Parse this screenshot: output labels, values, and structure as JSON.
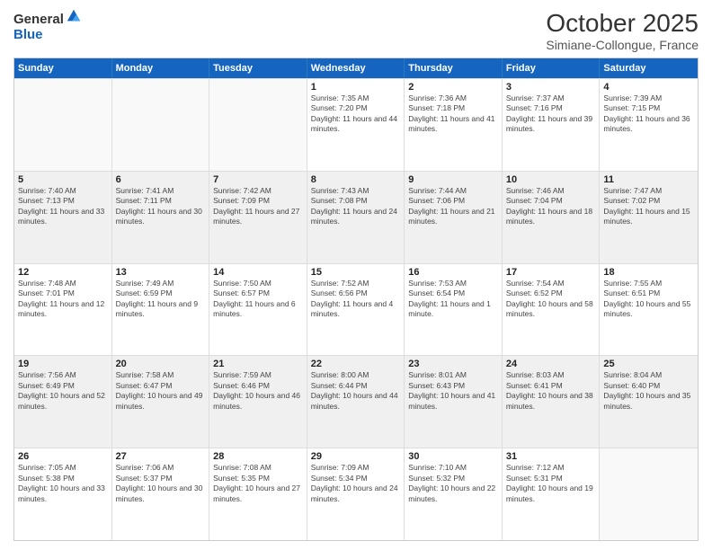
{
  "logo": {
    "general": "General",
    "blue": "Blue"
  },
  "title": "October 2025",
  "subtitle": "Simiane-Collongue, France",
  "header_days": [
    "Sunday",
    "Monday",
    "Tuesday",
    "Wednesday",
    "Thursday",
    "Friday",
    "Saturday"
  ],
  "rows": [
    [
      {
        "day": "",
        "info": ""
      },
      {
        "day": "",
        "info": ""
      },
      {
        "day": "",
        "info": ""
      },
      {
        "day": "1",
        "info": "Sunrise: 7:35 AM\nSunset: 7:20 PM\nDaylight: 11 hours and 44 minutes."
      },
      {
        "day": "2",
        "info": "Sunrise: 7:36 AM\nSunset: 7:18 PM\nDaylight: 11 hours and 41 minutes."
      },
      {
        "day": "3",
        "info": "Sunrise: 7:37 AM\nSunset: 7:16 PM\nDaylight: 11 hours and 39 minutes."
      },
      {
        "day": "4",
        "info": "Sunrise: 7:39 AM\nSunset: 7:15 PM\nDaylight: 11 hours and 36 minutes."
      }
    ],
    [
      {
        "day": "5",
        "info": "Sunrise: 7:40 AM\nSunset: 7:13 PM\nDaylight: 11 hours and 33 minutes."
      },
      {
        "day": "6",
        "info": "Sunrise: 7:41 AM\nSunset: 7:11 PM\nDaylight: 11 hours and 30 minutes."
      },
      {
        "day": "7",
        "info": "Sunrise: 7:42 AM\nSunset: 7:09 PM\nDaylight: 11 hours and 27 minutes."
      },
      {
        "day": "8",
        "info": "Sunrise: 7:43 AM\nSunset: 7:08 PM\nDaylight: 11 hours and 24 minutes."
      },
      {
        "day": "9",
        "info": "Sunrise: 7:44 AM\nSunset: 7:06 PM\nDaylight: 11 hours and 21 minutes."
      },
      {
        "day": "10",
        "info": "Sunrise: 7:46 AM\nSunset: 7:04 PM\nDaylight: 11 hours and 18 minutes."
      },
      {
        "day": "11",
        "info": "Sunrise: 7:47 AM\nSunset: 7:02 PM\nDaylight: 11 hours and 15 minutes."
      }
    ],
    [
      {
        "day": "12",
        "info": "Sunrise: 7:48 AM\nSunset: 7:01 PM\nDaylight: 11 hours and 12 minutes."
      },
      {
        "day": "13",
        "info": "Sunrise: 7:49 AM\nSunset: 6:59 PM\nDaylight: 11 hours and 9 minutes."
      },
      {
        "day": "14",
        "info": "Sunrise: 7:50 AM\nSunset: 6:57 PM\nDaylight: 11 hours and 6 minutes."
      },
      {
        "day": "15",
        "info": "Sunrise: 7:52 AM\nSunset: 6:56 PM\nDaylight: 11 hours and 4 minutes."
      },
      {
        "day": "16",
        "info": "Sunrise: 7:53 AM\nSunset: 6:54 PM\nDaylight: 11 hours and 1 minute."
      },
      {
        "day": "17",
        "info": "Sunrise: 7:54 AM\nSunset: 6:52 PM\nDaylight: 10 hours and 58 minutes."
      },
      {
        "day": "18",
        "info": "Sunrise: 7:55 AM\nSunset: 6:51 PM\nDaylight: 10 hours and 55 minutes."
      }
    ],
    [
      {
        "day": "19",
        "info": "Sunrise: 7:56 AM\nSunset: 6:49 PM\nDaylight: 10 hours and 52 minutes."
      },
      {
        "day": "20",
        "info": "Sunrise: 7:58 AM\nSunset: 6:47 PM\nDaylight: 10 hours and 49 minutes."
      },
      {
        "day": "21",
        "info": "Sunrise: 7:59 AM\nSunset: 6:46 PM\nDaylight: 10 hours and 46 minutes."
      },
      {
        "day": "22",
        "info": "Sunrise: 8:00 AM\nSunset: 6:44 PM\nDaylight: 10 hours and 44 minutes."
      },
      {
        "day": "23",
        "info": "Sunrise: 8:01 AM\nSunset: 6:43 PM\nDaylight: 10 hours and 41 minutes."
      },
      {
        "day": "24",
        "info": "Sunrise: 8:03 AM\nSunset: 6:41 PM\nDaylight: 10 hours and 38 minutes."
      },
      {
        "day": "25",
        "info": "Sunrise: 8:04 AM\nSunset: 6:40 PM\nDaylight: 10 hours and 35 minutes."
      }
    ],
    [
      {
        "day": "26",
        "info": "Sunrise: 7:05 AM\nSunset: 5:38 PM\nDaylight: 10 hours and 33 minutes."
      },
      {
        "day": "27",
        "info": "Sunrise: 7:06 AM\nSunset: 5:37 PM\nDaylight: 10 hours and 30 minutes."
      },
      {
        "day": "28",
        "info": "Sunrise: 7:08 AM\nSunset: 5:35 PM\nDaylight: 10 hours and 27 minutes."
      },
      {
        "day": "29",
        "info": "Sunrise: 7:09 AM\nSunset: 5:34 PM\nDaylight: 10 hours and 24 minutes."
      },
      {
        "day": "30",
        "info": "Sunrise: 7:10 AM\nSunset: 5:32 PM\nDaylight: 10 hours and 22 minutes."
      },
      {
        "day": "31",
        "info": "Sunrise: 7:12 AM\nSunset: 5:31 PM\nDaylight: 10 hours and 19 minutes."
      },
      {
        "day": "",
        "info": ""
      }
    ]
  ]
}
